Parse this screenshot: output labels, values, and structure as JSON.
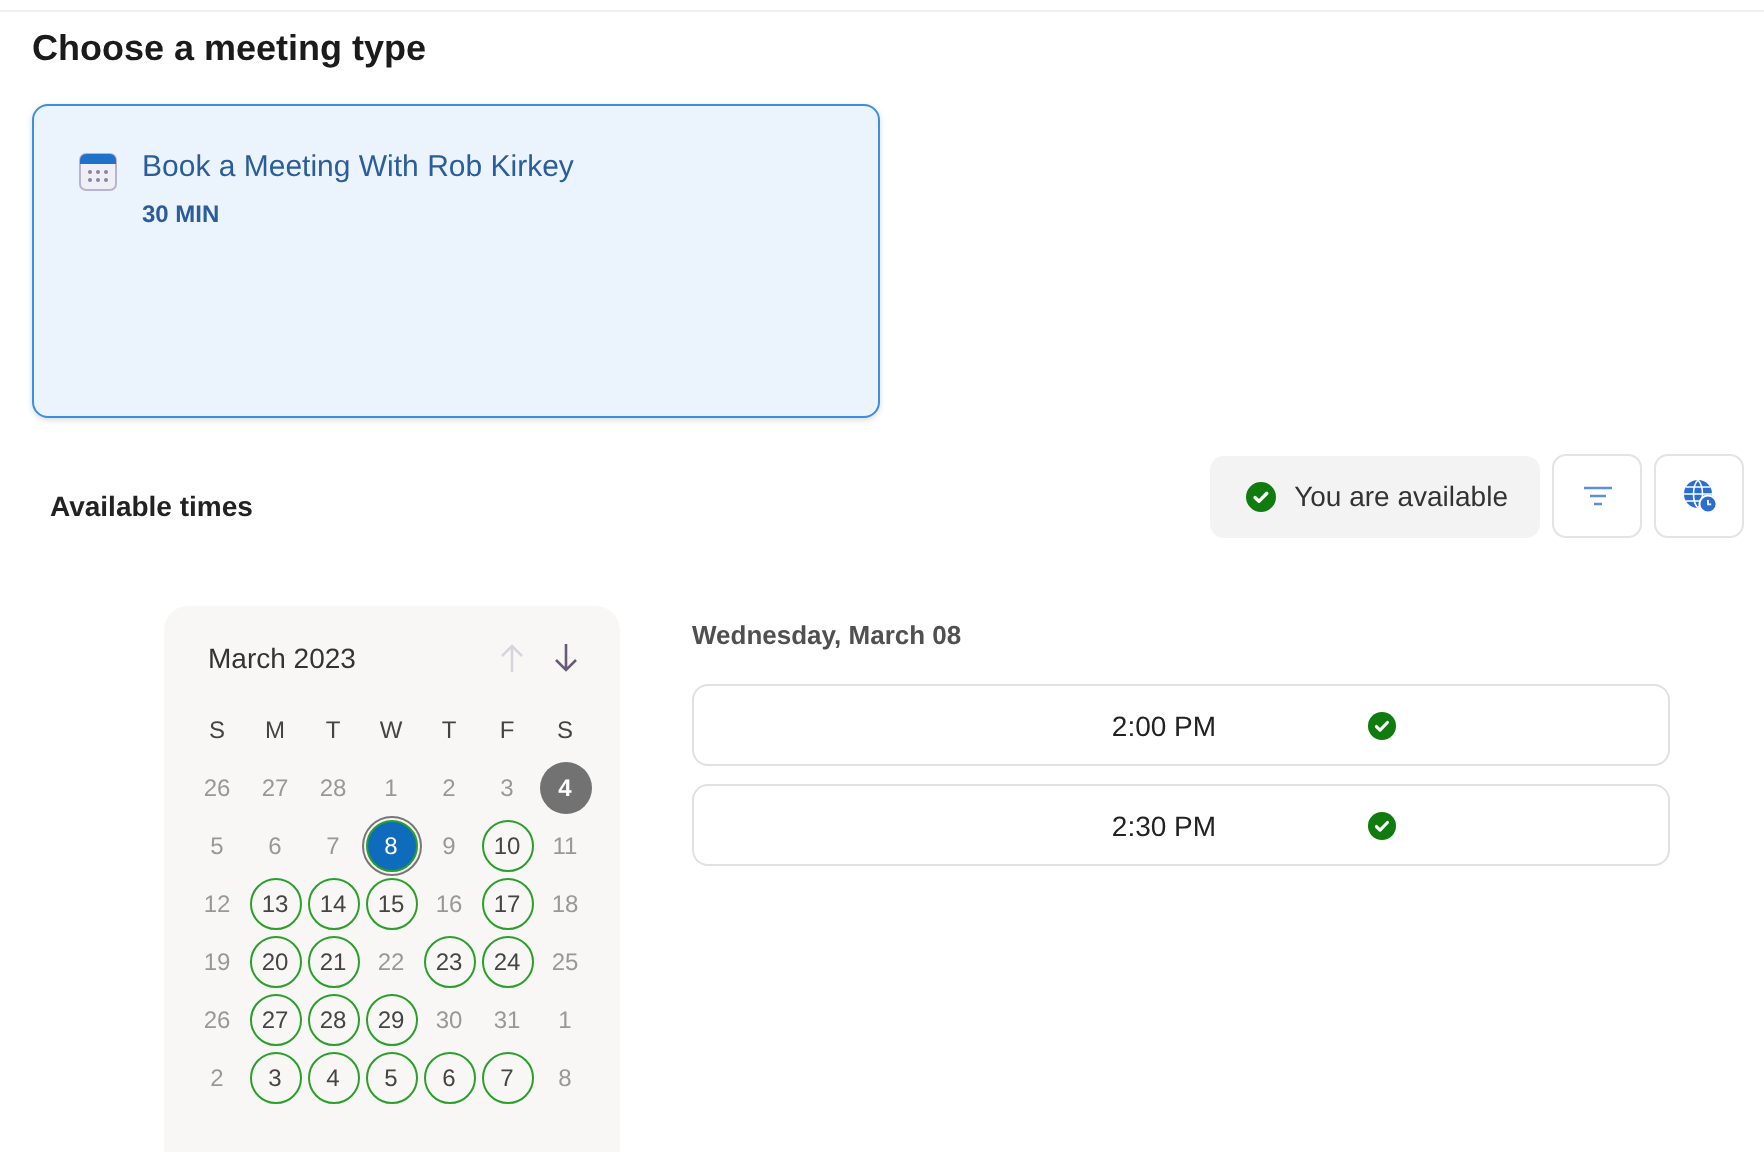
{
  "heading": "Choose a meeting type",
  "meeting_types": [
    {
      "title": "Book a Meeting With Rob Kirkey",
      "duration": "30 MIN",
      "selected": true
    }
  ],
  "available_times": {
    "label": "Available times",
    "status": "You are available"
  },
  "calendar": {
    "month": "March 2023",
    "weekdays": [
      "S",
      "M",
      "T",
      "W",
      "T",
      "F",
      "S"
    ],
    "weeks": [
      [
        {
          "day": "26",
          "kind": "plain",
          "selected": false
        },
        {
          "day": "27",
          "kind": "plain",
          "selected": false
        },
        {
          "day": "28",
          "kind": "plain",
          "selected": false
        },
        {
          "day": "1",
          "kind": "plain",
          "selected": false
        },
        {
          "day": "2",
          "kind": "plain",
          "selected": false
        },
        {
          "day": "3",
          "kind": "plain",
          "selected": false
        },
        {
          "day": "4",
          "kind": "today",
          "selected": false
        }
      ],
      [
        {
          "day": "5",
          "kind": "plain",
          "selected": false
        },
        {
          "day": "6",
          "kind": "plain",
          "selected": false
        },
        {
          "day": "7",
          "kind": "plain",
          "selected": false
        },
        {
          "day": "8",
          "kind": "available",
          "selected": true
        },
        {
          "day": "9",
          "kind": "plain",
          "selected": false
        },
        {
          "day": "10",
          "kind": "available",
          "selected": false
        },
        {
          "day": "11",
          "kind": "plain",
          "selected": false
        }
      ],
      [
        {
          "day": "12",
          "kind": "plain",
          "selected": false
        },
        {
          "day": "13",
          "kind": "available",
          "selected": false
        },
        {
          "day": "14",
          "kind": "available",
          "selected": false
        },
        {
          "day": "15",
          "kind": "available",
          "selected": false
        },
        {
          "day": "16",
          "kind": "plain",
          "selected": false
        },
        {
          "day": "17",
          "kind": "available",
          "selected": false
        },
        {
          "day": "18",
          "kind": "plain",
          "selected": false
        }
      ],
      [
        {
          "day": "19",
          "kind": "plain",
          "selected": false
        },
        {
          "day": "20",
          "kind": "available",
          "selected": false
        },
        {
          "day": "21",
          "kind": "available",
          "selected": false
        },
        {
          "day": "22",
          "kind": "plain",
          "selected": false
        },
        {
          "day": "23",
          "kind": "available",
          "selected": false
        },
        {
          "day": "24",
          "kind": "available",
          "selected": false
        },
        {
          "day": "25",
          "kind": "plain",
          "selected": false
        }
      ],
      [
        {
          "day": "26",
          "kind": "plain",
          "selected": false
        },
        {
          "day": "27",
          "kind": "available",
          "selected": false
        },
        {
          "day": "28",
          "kind": "available",
          "selected": false
        },
        {
          "day": "29",
          "kind": "available",
          "selected": false
        },
        {
          "day": "30",
          "kind": "plain",
          "selected": false
        },
        {
          "day": "31",
          "kind": "plain",
          "selected": false
        },
        {
          "day": "1",
          "kind": "plain",
          "selected": false
        }
      ],
      [
        {
          "day": "2",
          "kind": "plain",
          "selected": false
        },
        {
          "day": "3",
          "kind": "available",
          "selected": false
        },
        {
          "day": "4",
          "kind": "available",
          "selected": false
        },
        {
          "day": "5",
          "kind": "available",
          "selected": false
        },
        {
          "day": "6",
          "kind": "available",
          "selected": false
        },
        {
          "day": "7",
          "kind": "available",
          "selected": false
        },
        {
          "day": "8",
          "kind": "plain",
          "selected": false
        }
      ]
    ]
  },
  "schedule": {
    "date": "Wednesday, March 08",
    "slots": [
      {
        "time": "2:00 PM"
      },
      {
        "time": "2:30 PM"
      }
    ]
  }
}
